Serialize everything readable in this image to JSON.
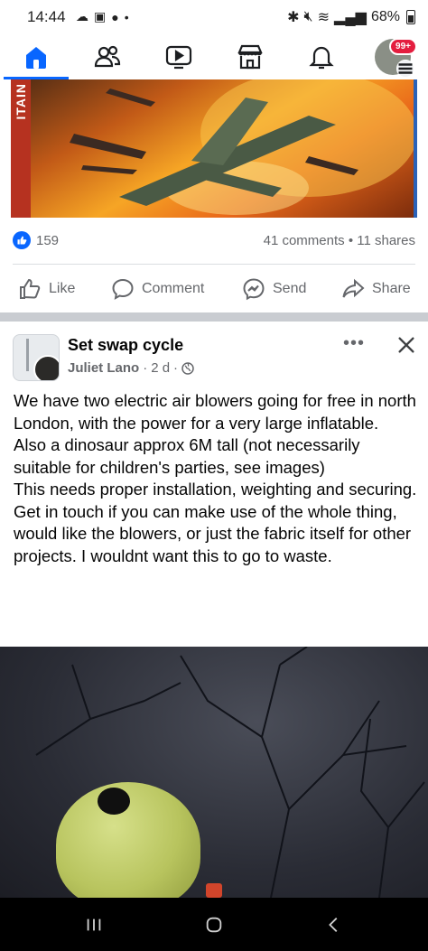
{
  "status_bar": {
    "time": "14:44",
    "battery": "68%"
  },
  "nav": {
    "tabs": [
      {
        "name": "home",
        "icon": "home-icon",
        "active": true
      },
      {
        "name": "friends",
        "icon": "friends-icon"
      },
      {
        "name": "video",
        "icon": "video-icon"
      },
      {
        "name": "marketplace",
        "icon": "marketplace-icon"
      },
      {
        "name": "notifications",
        "icon": "bell-icon"
      },
      {
        "name": "menu",
        "icon": "avatar-menu"
      }
    ],
    "notification_badge": "99+"
  },
  "previous_post": {
    "hero_side_text": "ITAIN",
    "reaction_count": "159",
    "comments_shares": "41 comments • 11 shares",
    "actions": {
      "like": "Like",
      "comment": "Comment",
      "send": "Send",
      "share": "Share"
    }
  },
  "post": {
    "group_name": "Set swap cycle",
    "author": "Juliet Lano",
    "time": "2 d",
    "more_label": "•••",
    "body": [
      "We have two electric air blowers going for free in north London, with the power for a very large inflatable.",
      "Also a dinosaur approx 6M tall (not necessarily suitable for children's parties, see images)",
      "This needs proper installation, weighting and securing.",
      "Get in touch if you can make use of the whole thing, would like the blowers, or just the fabric itself for other projects. I wouldnt want this to go to waste."
    ]
  },
  "colors": {
    "accent": "#0866ff",
    "secondary_text": "#65676b",
    "separator": "#c9ccd1",
    "badge": "#e41e3f"
  }
}
